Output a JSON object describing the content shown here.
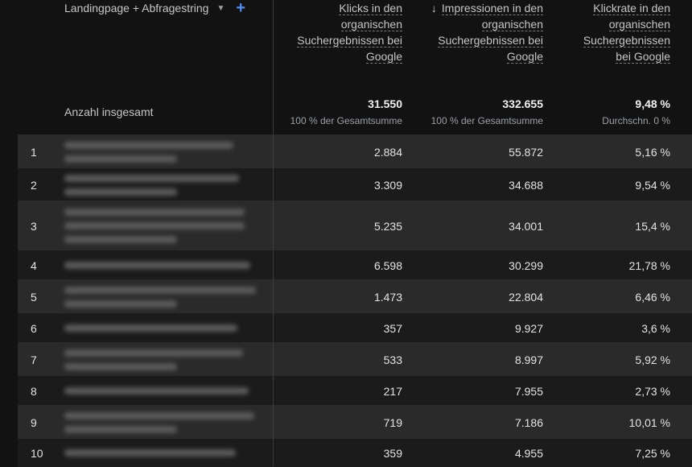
{
  "dimension": {
    "label": "Landingpage + Abfragestring"
  },
  "columns": [
    {
      "lines": [
        "Klicks in den",
        "organischen",
        "Suchergebnissen bei",
        "Google"
      ],
      "sort": ""
    },
    {
      "lines": [
        "Impressionen in den",
        "organischen",
        "Suchergebnissen bei",
        "Google"
      ],
      "sort": "descending"
    },
    {
      "lines": [
        "Klickrate in den",
        "organischen",
        "Suchergebnissen",
        "bei Google"
      ],
      "sort": ""
    }
  ],
  "totals": {
    "label": "Anzahl insgesamt",
    "values": [
      "31.550",
      "332.655",
      "9,48 %"
    ],
    "subs": [
      "100 % der Gesamtsumme",
      "100 % der Gesamtsumme",
      "Durchschn. 0 %"
    ]
  },
  "rows": [
    {
      "index": "1",
      "clicks": "2.884",
      "impressions": "55.872",
      "ctr": "5,16 %",
      "blur_lines": 2
    },
    {
      "index": "2",
      "clicks": "3.309",
      "impressions": "34.688",
      "ctr": "9,54 %",
      "blur_lines": 2
    },
    {
      "index": "3",
      "clicks": "5.235",
      "impressions": "34.001",
      "ctr": "15,4 %",
      "blur_lines": 3
    },
    {
      "index": "4",
      "clicks": "6.598",
      "impressions": "30.299",
      "ctr": "21,78 %",
      "blur_lines": 1
    },
    {
      "index": "5",
      "clicks": "1.473",
      "impressions": "22.804",
      "ctr": "6,46 %",
      "blur_lines": 2
    },
    {
      "index": "6",
      "clicks": "357",
      "impressions": "9.927",
      "ctr": "3,6 %",
      "blur_lines": 1
    },
    {
      "index": "7",
      "clicks": "533",
      "impressions": "8.997",
      "ctr": "5,92 %",
      "blur_lines": 2
    },
    {
      "index": "8",
      "clicks": "217",
      "impressions": "7.955",
      "ctr": "2,73 %",
      "blur_lines": 1
    },
    {
      "index": "9",
      "clicks": "719",
      "impressions": "7.186",
      "ctr": "10,01 %",
      "blur_lines": 2
    },
    {
      "index": "10",
      "clicks": "359",
      "impressions": "4.955",
      "ctr": "7,25 %",
      "blur_lines": 1
    }
  ]
}
